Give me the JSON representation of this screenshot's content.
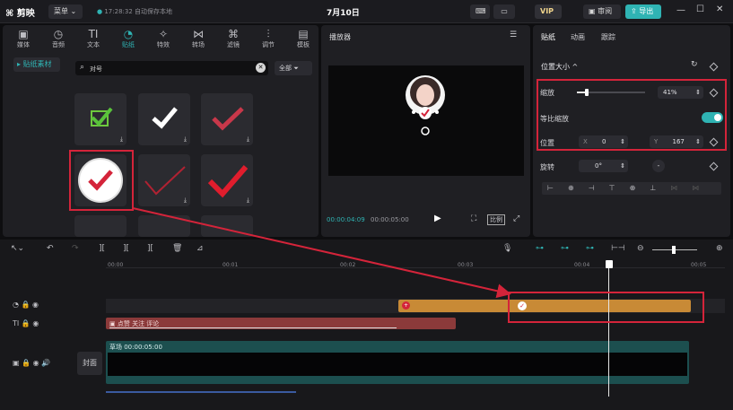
{
  "app": {
    "name": "剪映",
    "menu_label": "菜单",
    "save_status": "17:28:32 自动保存本地",
    "project_title": "7月10日",
    "vip": "VIP",
    "review_label": "审阅",
    "export_label": "导出"
  },
  "media_tabs": [
    {
      "label": "媒体",
      "icon": "media-icon",
      "glyph": "▣"
    },
    {
      "label": "音频",
      "icon": "audio-icon",
      "glyph": "◷"
    },
    {
      "label": "文本",
      "icon": "text-icon",
      "glyph": "TI"
    },
    {
      "label": "贴纸",
      "icon": "sticker-icon",
      "glyph": "◔"
    },
    {
      "label": "特效",
      "icon": "effects-icon",
      "glyph": "✧"
    },
    {
      "label": "转场",
      "icon": "transition-icon",
      "glyph": "⋈"
    },
    {
      "label": "滤镜",
      "icon": "filter-icon",
      "glyph": "⌘"
    },
    {
      "label": "调节",
      "icon": "adjust-icon",
      "glyph": "⫶"
    },
    {
      "label": "模板",
      "icon": "template-icon",
      "glyph": "▤"
    }
  ],
  "sticker_panel": {
    "category": "贴纸素材",
    "search_value": "对号",
    "filter_label": "全部"
  },
  "player": {
    "title": "播放器",
    "current_time": "00:00:04:09",
    "total_time": "00:00:05:00",
    "ratio_label": "比例"
  },
  "inspector": {
    "tabs": [
      "贴纸",
      "动画",
      "跟踪"
    ],
    "section": "位置大小",
    "scale_label": "缩放",
    "scale_value": "41%",
    "scale_level": 0.41,
    "uniform_label": "等比缩放",
    "position_label": "位置",
    "x_label": "X",
    "x_value": "0",
    "y_label": "Y",
    "y_value": "167",
    "rotate_label": "旋转",
    "rotate_value": "0°"
  },
  "ruler": {
    "ticks": [
      "00:00",
      "00:01",
      "00:02",
      "00:03",
      "00:04",
      "00:05"
    ]
  },
  "tracks": {
    "text_clip": "点赞 关注 评论",
    "main_clip_label": "草场 00:00:05:00",
    "cover_label": "封面"
  },
  "colors": {
    "accent": "#2fb3b3",
    "highlight": "#d4243a",
    "sticker_clip": "#c88a36",
    "text_clip": "#8b3a3a",
    "video_clip": "#1c4f4f"
  }
}
